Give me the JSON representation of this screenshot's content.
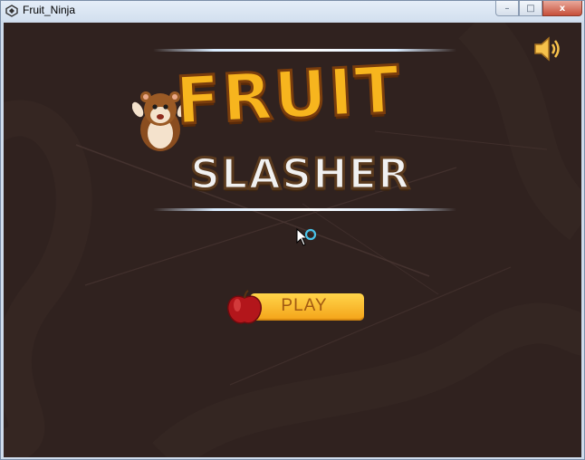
{
  "window": {
    "title": "Fruit_Ninja",
    "controls": [
      "minimize",
      "maximize",
      "close"
    ],
    "minimize_glyph": "–",
    "maximize_glyph": "□",
    "close_glyph": "x"
  },
  "game": {
    "logo_line1": "FRUIT",
    "logo_line2": "SLASHER",
    "play_label": "PLAY",
    "sound_icon": "speaker-on-icon",
    "mascot": "hamster",
    "play_icon": "apple",
    "colors": {
      "background": "#30221f",
      "logo_fruit": "#f7b51e",
      "logo_slasher": "#f1f1f1",
      "play_button": "#f7b52a",
      "play_text": "#a25a12"
    }
  }
}
